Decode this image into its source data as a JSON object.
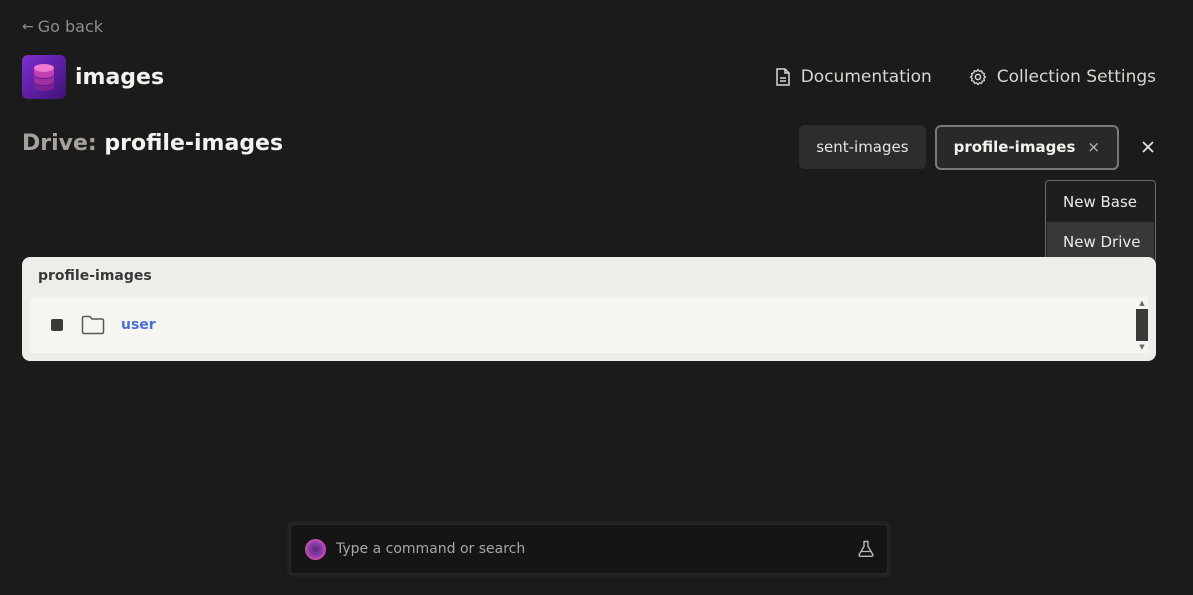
{
  "nav": {
    "go_back_label": "Go back",
    "go_back_arrow": "←"
  },
  "header": {
    "title": "images",
    "icon": "database-stack-icon",
    "documentation_label": "Documentation",
    "collection_settings_label": "Collection Settings"
  },
  "drive": {
    "prefix": "Drive:",
    "name": "profile-images"
  },
  "tabs": [
    {
      "label": "sent-images",
      "active": false
    },
    {
      "label": "profile-images",
      "active": true,
      "close_glyph": "×"
    }
  ],
  "close_all_glyph": "✕",
  "dropdown": {
    "items": [
      {
        "label": "New Base"
      },
      {
        "label": "New Drive"
      }
    ]
  },
  "panel": {
    "title": "profile-images",
    "rows": [
      {
        "name": "user",
        "type": "folder"
      }
    ]
  },
  "command_bar": {
    "placeholder": "Type a command or search"
  },
  "colors": {
    "background": "#1c1b1b",
    "panel": "#efede9",
    "link": "#4a6fd4",
    "accent_purple": "#7d2fd0"
  }
}
